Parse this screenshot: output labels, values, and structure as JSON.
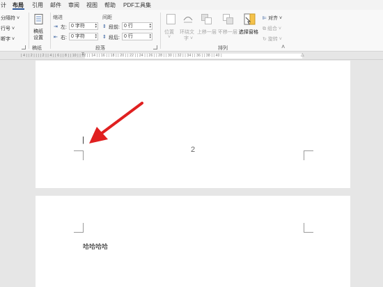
{
  "tabs": [
    "计",
    "布局",
    "引用",
    "邮件",
    "审阅",
    "视图",
    "帮助",
    "PDF工具集"
  ],
  "active_tab": "布局",
  "ribbon": {
    "page_setup": {
      "breaks": "分隔符",
      "line_numbers": "行号",
      "hyphenation": "断字"
    },
    "manuscript": {
      "button_line1": "稿纸",
      "button_line2": "设置",
      "group_label": "稿纸"
    },
    "indent": {
      "header": "缩进",
      "left_label": "左:",
      "left_value": "0 字符",
      "right_label": "右:",
      "right_value": "0 字符"
    },
    "spacing": {
      "header": "间距",
      "before_label": "段前:",
      "before_value": "0 行",
      "after_label": "段后:",
      "after_value": "0 行"
    },
    "paragraph_group_label": "段落",
    "arrange": {
      "position": "位置",
      "wrap_text_line1": "环绕文",
      "wrap_text_line2": "字",
      "bring_forward": "上移一层",
      "send_backward": "下移一层",
      "selection_pane": "选择窗格",
      "align": "对齐",
      "group": "组合",
      "rotate": "旋转",
      "group_label": "排列"
    }
  },
  "ruler_numbers": "| 4 | | 2 | | | | 2 | | 4 | | 6 | | 8 | | 10 | | 12 | | 14 | | 16 | | 18 | | 20 | | 22 | | 24 | | 26 | | 28 | | 30 | | 32 | | 34 | | 36 | | 38 | | 40 |",
  "document": {
    "page_number": "2",
    "next_page_text": "哈哈哈哈"
  },
  "colors": {
    "accent": "#2b579a",
    "annotation_arrow": "#e02020",
    "page_background": "#ffffff",
    "canvas_background": "#e6e6e6"
  }
}
